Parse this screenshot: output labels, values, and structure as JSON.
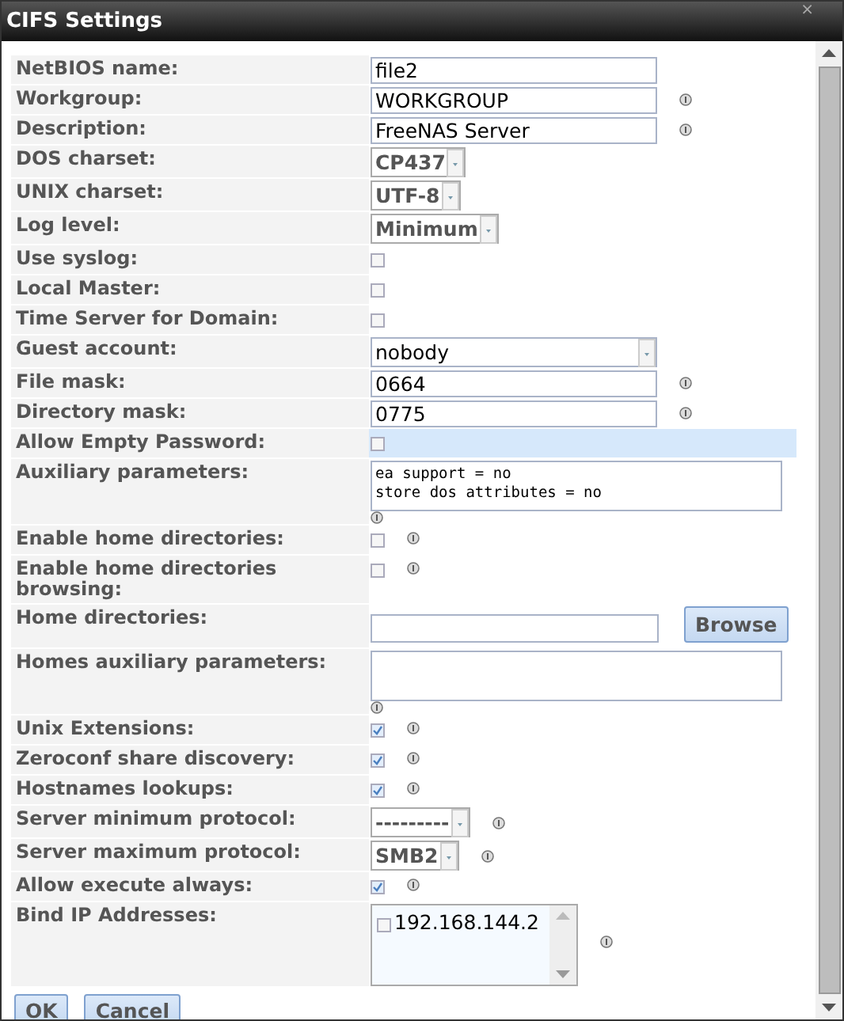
{
  "window": {
    "title": "CIFS Settings",
    "close": "×"
  },
  "rows": [
    {
      "label": "NetBIOS name:",
      "kind": "text",
      "value": "file2",
      "info": false,
      "highlighted": false
    },
    {
      "label": "Workgroup:",
      "kind": "text",
      "value": "WORKGROUP",
      "info": true,
      "highlighted": false
    },
    {
      "label": "Description:",
      "kind": "text",
      "value": "FreeNAS Server",
      "info": true,
      "highlighted": false
    },
    {
      "label": "DOS charset:",
      "kind": "select",
      "value": "CP437",
      "info": false,
      "highlighted": false
    },
    {
      "label": "UNIX charset:",
      "kind": "select",
      "value": "UTF-8",
      "info": false,
      "highlighted": false
    },
    {
      "label": "Log level:",
      "kind": "select",
      "value": "Minimum",
      "info": false,
      "highlighted": false
    },
    {
      "label": "Use syslog:",
      "kind": "checkbox",
      "checked": false,
      "info": false,
      "highlighted": false
    },
    {
      "label": "Local Master:",
      "kind": "checkbox",
      "checked": false,
      "info": false,
      "highlighted": false
    },
    {
      "label": "Time Server for Domain:",
      "kind": "checkbox",
      "checked": false,
      "info": false,
      "highlighted": false
    },
    {
      "label": "Guest account:",
      "kind": "combo",
      "value": "nobody",
      "info": false,
      "highlighted": false
    },
    {
      "label": "File mask:",
      "kind": "text",
      "value": "0664",
      "info": true,
      "highlighted": false
    },
    {
      "label": "Directory mask:",
      "kind": "text",
      "value": "0775",
      "info": true,
      "highlighted": false
    },
    {
      "label": "Allow Empty Password:",
      "kind": "checkbox",
      "checked": false,
      "info": false,
      "highlighted": true
    },
    {
      "label": "Auxiliary parameters:",
      "kind": "textarea",
      "lines": [
        "ea support = no",
        "store dos attributes = no"
      ],
      "info": true,
      "highlighted": false
    },
    {
      "label": "Enable home directories:",
      "kind": "checkbox",
      "checked": false,
      "info": true,
      "highlighted": false
    },
    {
      "label": "Enable home directories browsing:",
      "kind": "checkbox",
      "checked": false,
      "info": true,
      "highlighted": false
    },
    {
      "label": "Home directories:",
      "kind": "path",
      "button": "Browse",
      "highlighted": false
    },
    {
      "label": "Homes auxiliary parameters:",
      "kind": "textarea",
      "lines": [],
      "info": true,
      "highlighted": false
    },
    {
      "label": "Unix Extensions:",
      "kind": "checkbox",
      "checked": true,
      "info": true,
      "highlighted": false
    },
    {
      "label": "Zeroconf share discovery:",
      "kind": "checkbox",
      "checked": true,
      "info": true,
      "highlighted": false
    },
    {
      "label": "Hostnames lookups:",
      "kind": "checkbox",
      "checked": true,
      "info": true,
      "highlighted": false
    },
    {
      "label": "Server minimum protocol:",
      "kind": "select",
      "value": "---------",
      "info": true,
      "highlighted": false
    },
    {
      "label": "Server maximum protocol:",
      "kind": "select",
      "value": "SMB2",
      "info": true,
      "highlighted": false
    },
    {
      "label": "Allow execute always:",
      "kind": "checkbox",
      "checked": true,
      "info": true,
      "highlighted": false
    },
    {
      "label": "Bind IP Addresses:",
      "kind": "multiselect",
      "options": [
        {
          "label": "192.168.144.2",
          "checked": false
        }
      ],
      "info": true,
      "highlighted": false
    }
  ],
  "buttons": [
    "OK",
    "Cancel"
  ]
}
